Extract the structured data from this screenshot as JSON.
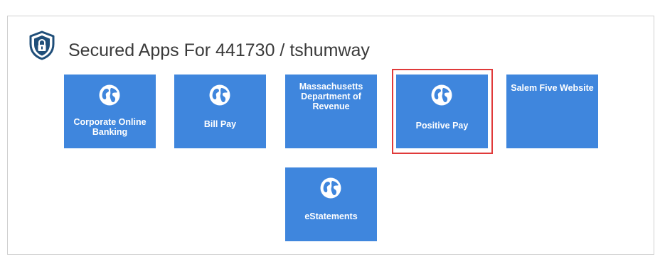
{
  "header": {
    "title": "Secured Apps For 441730 / tshumway",
    "icon": "shield-lock-icon",
    "icon_color": "#1f4e79"
  },
  "tiles": [
    {
      "label": "Corporate Online Banking",
      "icon": "globe-icon",
      "selected": false
    },
    {
      "label": "Bill Pay",
      "icon": "globe-icon",
      "selected": false
    },
    {
      "label": "Massachusetts Department of Revenue",
      "icon": null,
      "selected": false
    },
    {
      "label": "Positive Pay",
      "icon": "globe-icon",
      "selected": true
    },
    {
      "label": "Salem Five Website",
      "icon": null,
      "selected": false
    },
    {
      "label": "eStatements",
      "icon": "globe-icon",
      "selected": false
    }
  ],
  "colors": {
    "tile_background": "#3f86dd",
    "tile_text": "#ffffff",
    "selection_border": "#e03a3a"
  }
}
